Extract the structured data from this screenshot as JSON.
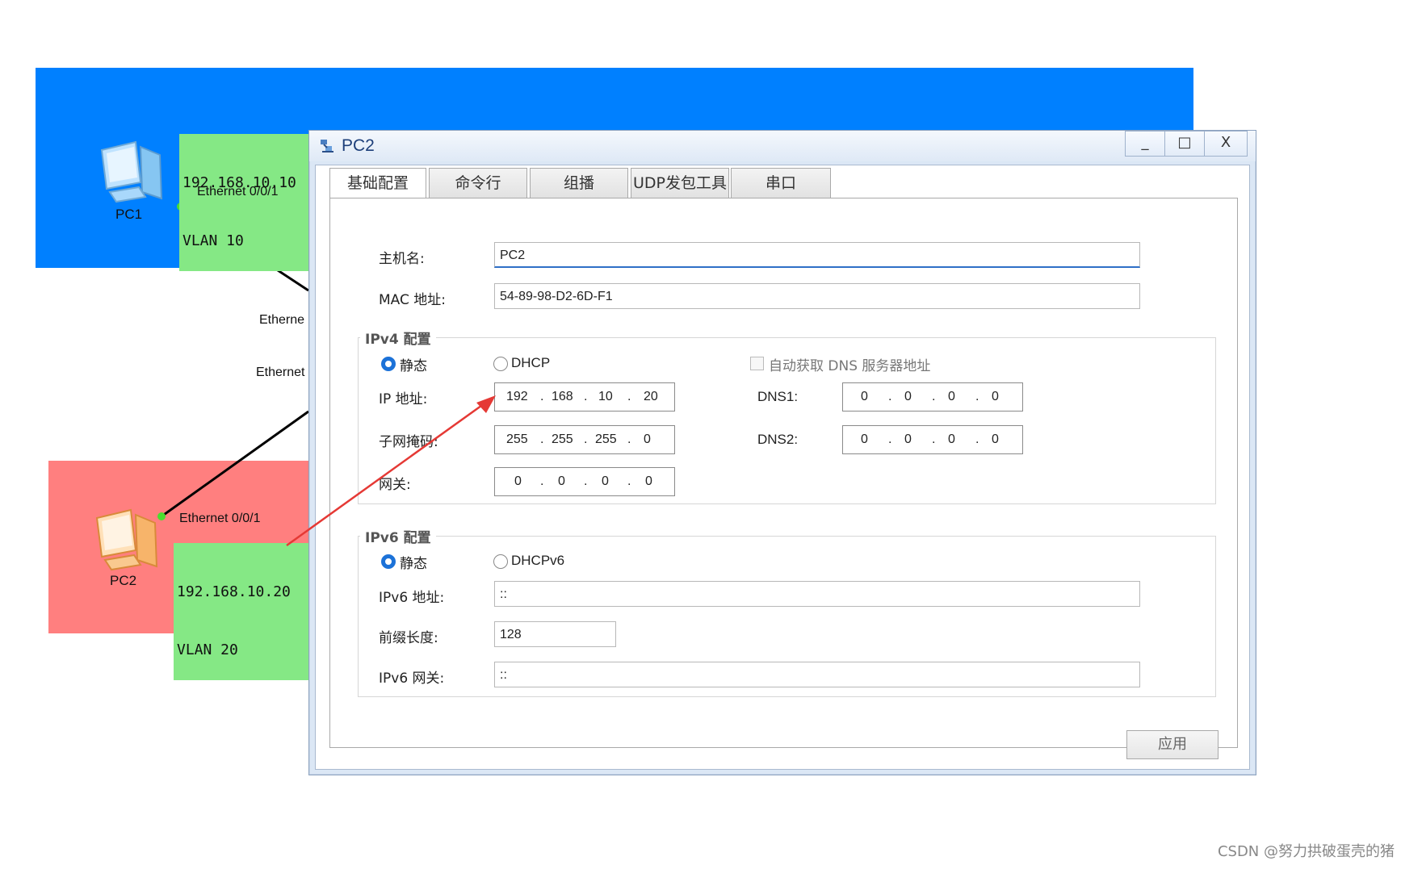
{
  "topology": {
    "pc1": {
      "name": "PC1",
      "ip": "192.168.10.10",
      "vlan": "VLAN 10",
      "port": "Ethernet 0/0/1"
    },
    "pc2": {
      "name": "PC2",
      "ip": "192.168.10.20",
      "vlan": "VLAN 20",
      "port": "Ethernet 0/0/1"
    },
    "switch_port_top": "Etherne",
    "switch_port_bottom": "Ethernet",
    "colors": {
      "vlan10_area": "#0080ff",
      "vlan20_area": "#ff7f7f",
      "label_bg": "#85e885",
      "arrow": "#e53935"
    }
  },
  "dialog": {
    "title": "PC2",
    "window_controls": {
      "minimize": "_",
      "maximize": "□",
      "close": "X"
    },
    "tabs": [
      "基础配置",
      "命令行",
      "组播",
      "UDP发包工具",
      "串口"
    ],
    "active_tab": "基础配置",
    "hostname": {
      "label": "主机名:",
      "value": "PC2"
    },
    "mac": {
      "label": "MAC 地址:",
      "value": "54-89-98-D2-6D-F1"
    },
    "ipv4": {
      "group_title": "IPv4 配置",
      "static_label": "静态",
      "dhcp_label": "DHCP",
      "mode": "静态",
      "auto_dns_label": "自动获取 DNS 服务器地址",
      "auto_dns_checked": false,
      "ip": {
        "label": "IP 地址:",
        "octets": [
          "192",
          "168",
          "10",
          "20"
        ]
      },
      "mask": {
        "label": "子网掩码:",
        "octets": [
          "255",
          "255",
          "255",
          "0"
        ]
      },
      "gateway": {
        "label": "网关:",
        "octets": [
          "0",
          "0",
          "0",
          "0"
        ]
      },
      "dns1": {
        "label": "DNS1:",
        "octets": [
          "0",
          "0",
          "0",
          "0"
        ]
      },
      "dns2": {
        "label": "DNS2:",
        "octets": [
          "0",
          "0",
          "0",
          "0"
        ]
      }
    },
    "ipv6": {
      "group_title": "IPv6 配置",
      "static_label": "静态",
      "dhcp_label": "DHCPv6",
      "mode": "静态",
      "address": {
        "label": "IPv6 地址:",
        "value": "::"
      },
      "prefix": {
        "label": "前缀长度:",
        "value": "128"
      },
      "gateway": {
        "label": "IPv6 网关:",
        "value": "::"
      }
    },
    "apply_label": "应用"
  },
  "watermark": "CSDN @努力拱破蛋壳的猪"
}
